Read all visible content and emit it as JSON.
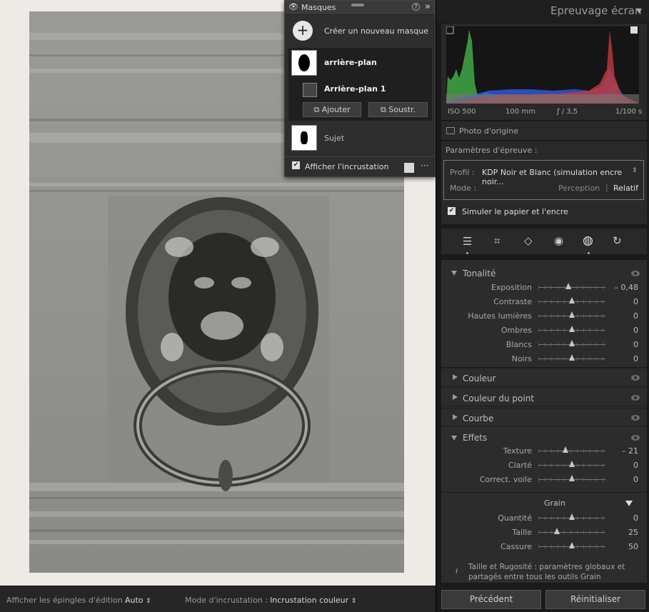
{
  "bottom_bar": {
    "pins_label": "Afficher les épingles d'édition :",
    "pins_value": "Auto",
    "overlay_label": "Mode d'incrustation :",
    "overlay_value": "Incrustation couleur"
  },
  "masks": {
    "title": "Masques",
    "create_label": "Créer un nouveau masque",
    "items": [
      {
        "name": "arrière-plan"
      },
      {
        "name": "Arrière-plan 1"
      },
      {
        "name": "Sujet"
      }
    ],
    "add_label": "Ajouter",
    "subtract_label": "Soustr.",
    "overlay_label": "Afficher l'incrustation",
    "overlay_checked": true
  },
  "right": {
    "header_title": "Epreuvage écran",
    "histogram_info": {
      "iso": "ISO 500",
      "focal": "100 mm",
      "aperture": "ƒ / 3,5",
      "shutter": "1/100 s"
    },
    "original_photo_label": "Photo d'origine",
    "proof_params_label": "Paramètres d'épreuve :",
    "profile_label": "Profil :",
    "profile_value": "KDP Noir et Blanc (simulation encre noir...",
    "mode_label": "Mode :",
    "mode_perception": "Perception",
    "mode_relative": "Relatif",
    "simulate_label": "Simuler le papier et l'encre",
    "simulate_checked": true,
    "tools": [
      "sliders-icon",
      "crop-icon",
      "eraser-icon",
      "redeye-icon",
      "mask-icon",
      "reset-icon"
    ],
    "tone": {
      "title": "Tonalité",
      "sliders": [
        {
          "label": "Exposition",
          "value": "– 0,48",
          "pos": 0.45
        },
        {
          "label": "Contraste",
          "value": "0",
          "pos": 0.5
        },
        {
          "label": "Hautes lumières",
          "value": "0",
          "pos": 0.5
        },
        {
          "label": "Ombres",
          "value": "0",
          "pos": 0.5
        },
        {
          "label": "Blancs",
          "value": "0",
          "pos": 0.5
        },
        {
          "label": "Noirs",
          "value": "0",
          "pos": 0.5
        }
      ]
    },
    "collapsed_sections": [
      "Couleur",
      "Couleur du point",
      "Courbe"
    ],
    "effects": {
      "title": "Effets",
      "sliders": [
        {
          "label": "Texture",
          "value": "– 21",
          "pos": 0.4
        },
        {
          "label": "Clarté",
          "value": "0",
          "pos": 0.5
        },
        {
          "label": "Correct. voile",
          "value": "0",
          "pos": 0.5
        }
      ],
      "grain_title": "Grain",
      "grain_sliders": [
        {
          "label": "Quantité",
          "value": "0",
          "pos": 0.5
        },
        {
          "label": "Taille",
          "value": "25",
          "pos": 0.28
        },
        {
          "label": "Cassure",
          "value": "50",
          "pos": 0.5
        }
      ],
      "info_text": "Taille et Rugosité : paramètres globaux et partagés entre tous les outils Grain"
    },
    "prev_label": "Précédent",
    "reset_label": "Réinitialiser"
  }
}
